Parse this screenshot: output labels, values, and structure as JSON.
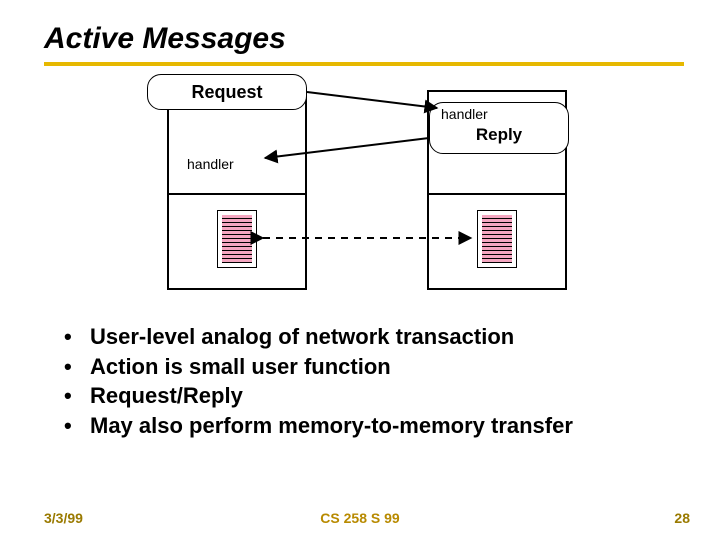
{
  "title": "Active Messages",
  "diagram": {
    "request_label": "Request",
    "reply_label": "Reply",
    "handler_label": "handler"
  },
  "bullets": [
    "User-level analog of network transaction",
    "Action is small user function",
    "Request/Reply",
    "May also perform memory-to-memory transfer"
  ],
  "footer": {
    "date": "3/3/99",
    "course": "CS 258 S 99",
    "page": "28"
  }
}
